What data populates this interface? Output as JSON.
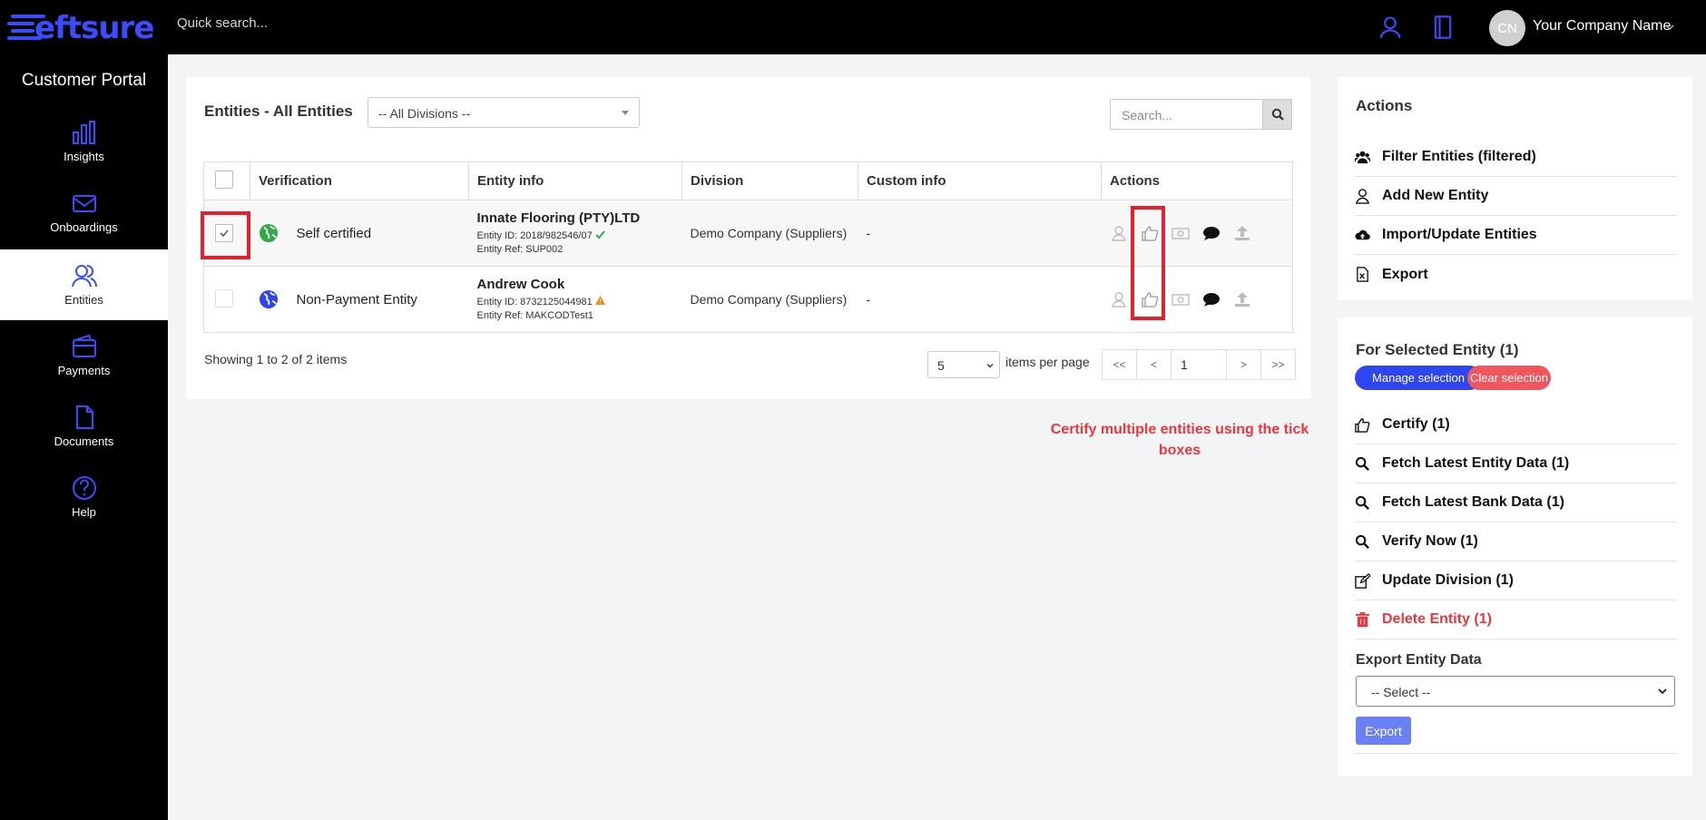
{
  "header": {
    "logo_text": "eftsure",
    "quick_search_placeholder": "Quick search...",
    "avatar_initials": "CN",
    "company_name": "Your Company Name",
    "icons": [
      "user-icon",
      "book-icon",
      "chevron-down-icon"
    ]
  },
  "sidebar": {
    "title": "Customer Portal",
    "items": [
      {
        "label": "Insights",
        "icon": "bar-chart-icon"
      },
      {
        "label": "Onboardings",
        "icon": "envelope-icon"
      },
      {
        "label": "Entities",
        "icon": "users-icon",
        "active": true
      },
      {
        "label": "Payments",
        "icon": "wallet-icon"
      },
      {
        "label": "Documents",
        "icon": "document-icon"
      },
      {
        "label": "Help",
        "icon": "help-icon"
      }
    ]
  },
  "main": {
    "title": "Entities - All Entities",
    "division_select": "-- All Divisions --",
    "search_placeholder": "Search...",
    "columns": [
      "Verification",
      "Entity info",
      "Division",
      "Custom info",
      "Actions"
    ],
    "rows": [
      {
        "checked": true,
        "verification": "Self certified",
        "name": "Innate Flooring (PTY)LTD",
        "entity_id": "Entity ID: 2018/982546/07",
        "entity_ref": "Entity Ref: SUP002",
        "division": "Demo Company (Suppliers)",
        "custom_info": "-"
      },
      {
        "checked": false,
        "verification": "Non-Payment Entity",
        "name": "Andrew Cook",
        "entity_id": "Entity ID: 8732125044981",
        "entity_ref": "Entity Ref: MAKCODTest1",
        "division": "Demo Company (Suppliers)",
        "custom_info": "-"
      }
    ],
    "showing": "Showing 1 to 2 of 2 items",
    "per_page": "5",
    "items_per_page_label": "items per page",
    "pager": {
      "first": "<<",
      "prev": "<",
      "page": "1",
      "next": ">",
      "last": ">>"
    }
  },
  "hint": {
    "line1": "Certify multiple entities using the tick",
    "line2": "boxes"
  },
  "actions_panel": {
    "title": "Actions",
    "items": [
      "Filter Entities (filtered)",
      "Add New Entity",
      "Import/Update Entities",
      "Export"
    ]
  },
  "selected_panel": {
    "title": "For Selected Entity (1)",
    "manage_selection": "Manage selection",
    "clear_selection": "Clear selection",
    "items": [
      "Certify (1)",
      "Fetch Latest Entity Data (1)",
      "Fetch Latest Bank Data (1)",
      "Verify Now (1)",
      "Update Division (1)",
      "Delete Entity (1)"
    ],
    "export_label": "Export Entity Data",
    "export_select": "-- Select --",
    "export_button": "Export"
  },
  "colors": {
    "brand": "#3b4cff",
    "highlight": "#e3202d",
    "danger": "#e8383d",
    "pill_blue": "#2f45f0",
    "pill_red": "#f2555b"
  }
}
